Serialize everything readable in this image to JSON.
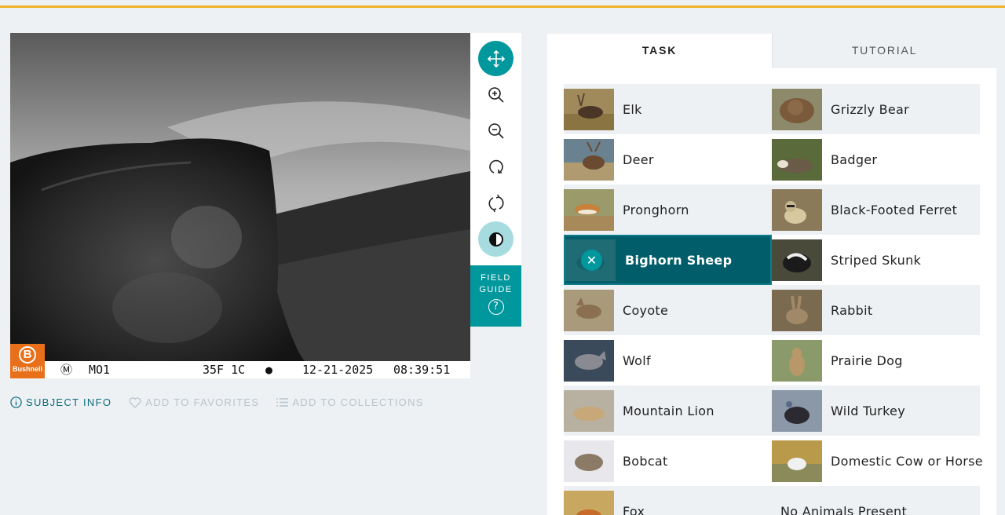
{
  "camera": {
    "brand": "Bushnell",
    "brand_initial": "B",
    "mode": "M",
    "camera_id": "MO1",
    "temperature": "35F 1C",
    "moon_icon": "moon-phase-icon",
    "date": "12-21-2025",
    "time": "08:39:51"
  },
  "toolbar": {
    "tools": [
      {
        "name": "move-icon",
        "active": true
      },
      {
        "name": "zoom-in-icon",
        "active": false
      },
      {
        "name": "zoom-out-icon",
        "active": false
      },
      {
        "name": "rotate-icon",
        "active": false
      },
      {
        "name": "reset-icon",
        "active": false
      },
      {
        "name": "invert-icon",
        "active": true
      }
    ],
    "field_guide_line1": "FIELD",
    "field_guide_line2": "GUIDE",
    "field_guide_icon": "?"
  },
  "meta": {
    "subject_info": "SUBJECT INFO",
    "add_favorites": "ADD TO FAVORITES",
    "add_collections": "ADD TO COLLECTIONS"
  },
  "tabs": {
    "task": "TASK",
    "tutorial": "TUTORIAL"
  },
  "choices": {
    "elk": "Elk",
    "grizzly": "Grizzly Bear",
    "deer": "Deer",
    "badger": "Badger",
    "pronghorn": "Pronghorn",
    "ferret": "Black-Footed Ferret",
    "bighorn": "Bighorn Sheep",
    "skunk": "Striped Skunk",
    "coyote": "Coyote",
    "rabbit": "Rabbit",
    "wolf": "Wolf",
    "prairie_dog": "Prairie Dog",
    "mountain_lion": "Mountain Lion",
    "wild_turkey": "Wild Turkey",
    "bobcat": "Bobcat",
    "cow_horse": "Domestic Cow or Horse",
    "fox": "Fox",
    "no_animals": "No Animals Present",
    "selected": "Bighorn Sheep",
    "deselect_glyph": "✕"
  },
  "colors": {
    "accent": "#00979d",
    "selected_bg": "#005d69",
    "top_rule": "#f0b429",
    "subject_info_text": "#0b6b7a"
  }
}
